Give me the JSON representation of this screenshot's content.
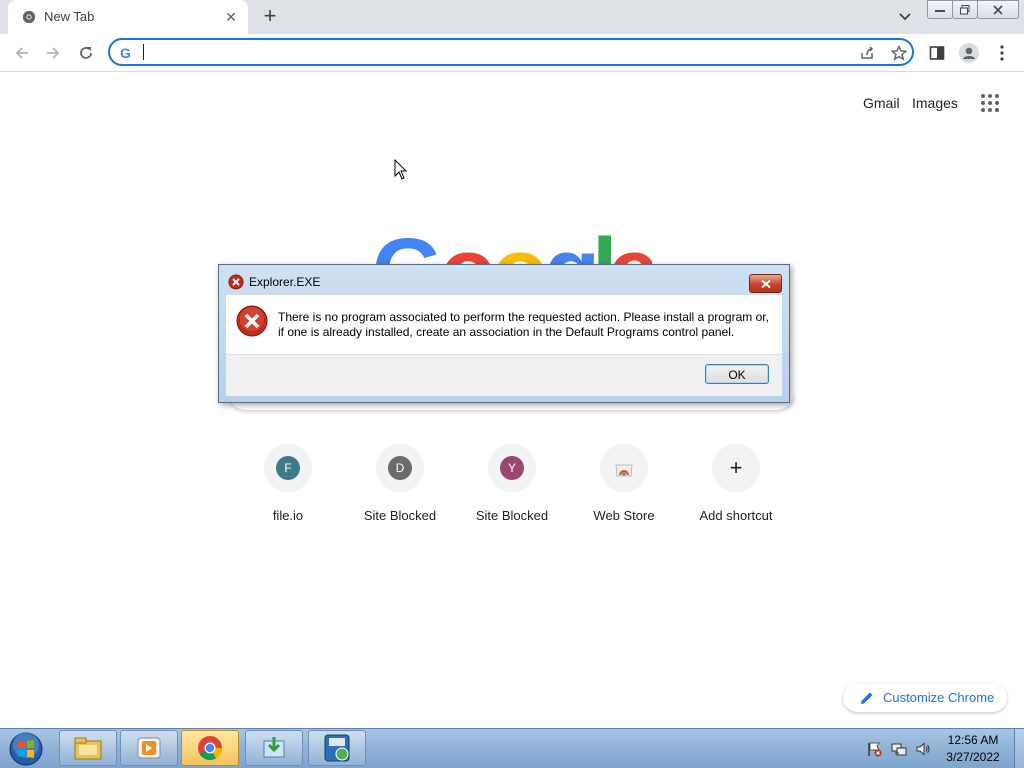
{
  "browser": {
    "tab": {
      "title": "New Tab",
      "close": "✕"
    },
    "new_tab": "+",
    "omnibox": {
      "value": "",
      "placeholder": "",
      "g": "G"
    }
  },
  "ntp": {
    "links": {
      "gmail": "Gmail",
      "images": "Images"
    },
    "logo_letters": [
      "G",
      "o",
      "o",
      "g",
      "l",
      "e"
    ],
    "shortcuts": [
      {
        "initial": "F",
        "label": "file.io",
        "color": "#3d7b88"
      },
      {
        "initial": "D",
        "label": "Site Blocked",
        "color": "#6b6b6b"
      },
      {
        "initial": "Y",
        "label": "Site Blocked",
        "color": "#9c4672"
      },
      {
        "initial": "",
        "label": "Web Store",
        "color": "#f1f3f4"
      },
      {
        "initial": "+",
        "label": "Add shortcut",
        "color": "#f1f3f4"
      }
    ],
    "customize_label": "Customize Chrome"
  },
  "dialog": {
    "title": "Explorer.EXE",
    "message": "There is no program associated to perform the requested action. Please install a program or, if one is already installed, create an association in the Default Programs control panel.",
    "ok_label": "OK"
  },
  "taskbar": {
    "clock": {
      "time": "12:56 AM",
      "date": "3/27/2022"
    }
  },
  "colors": {
    "accent": "#1a73e8",
    "error": "#c42b1c"
  }
}
